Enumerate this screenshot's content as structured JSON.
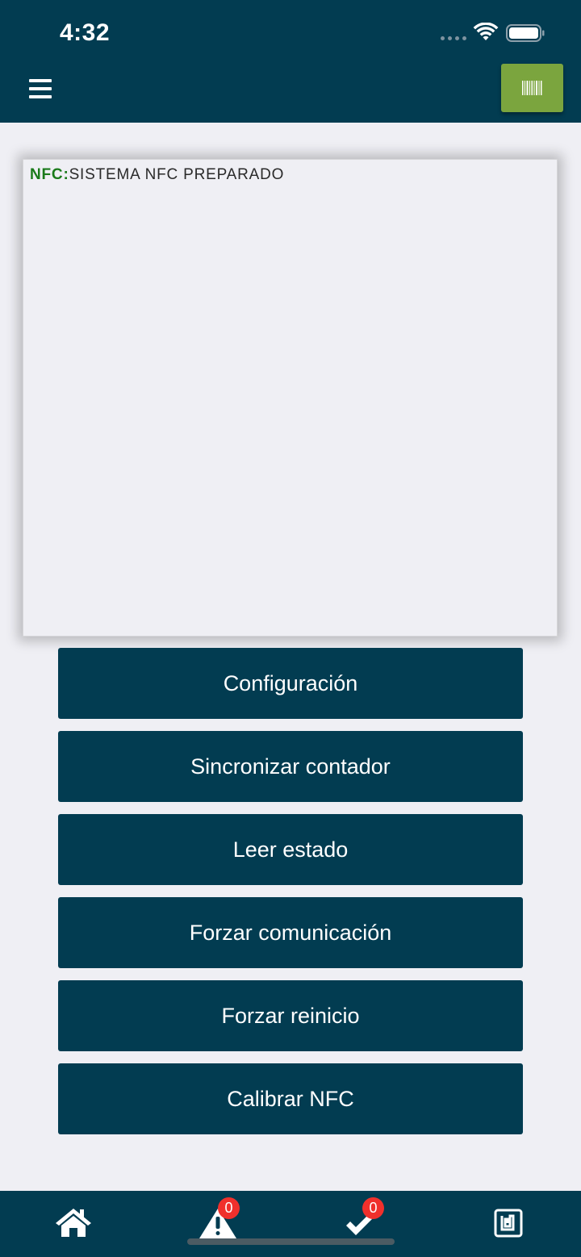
{
  "status_bar": {
    "time": "4:32"
  },
  "header": {
    "menu_icon": "hamburger-menu-icon",
    "scan_icon": "barcode-icon",
    "scan_button_color": "#7ba53e"
  },
  "console": {
    "label": "NFC:",
    "message": "SISTEMA NFC PREPARADO",
    "label_color": "#1a7a1a"
  },
  "actions": [
    {
      "label": "Configuración"
    },
    {
      "label": "Sincronizar contador"
    },
    {
      "label": "Leer estado"
    },
    {
      "label": "Forzar comunicación"
    },
    {
      "label": "Forzar reinicio"
    },
    {
      "label": "Calibrar NFC"
    }
  ],
  "tabbar": {
    "home": {
      "icon": "home-icon"
    },
    "alerts": {
      "icon": "warning-icon",
      "badge": "0"
    },
    "done": {
      "icon": "checkmark-icon",
      "badge": "0"
    },
    "nfc": {
      "icon": "nfc-icon"
    }
  },
  "colors": {
    "primary": "#023c51",
    "background": "#efeff4",
    "badge": "#f0302c"
  }
}
